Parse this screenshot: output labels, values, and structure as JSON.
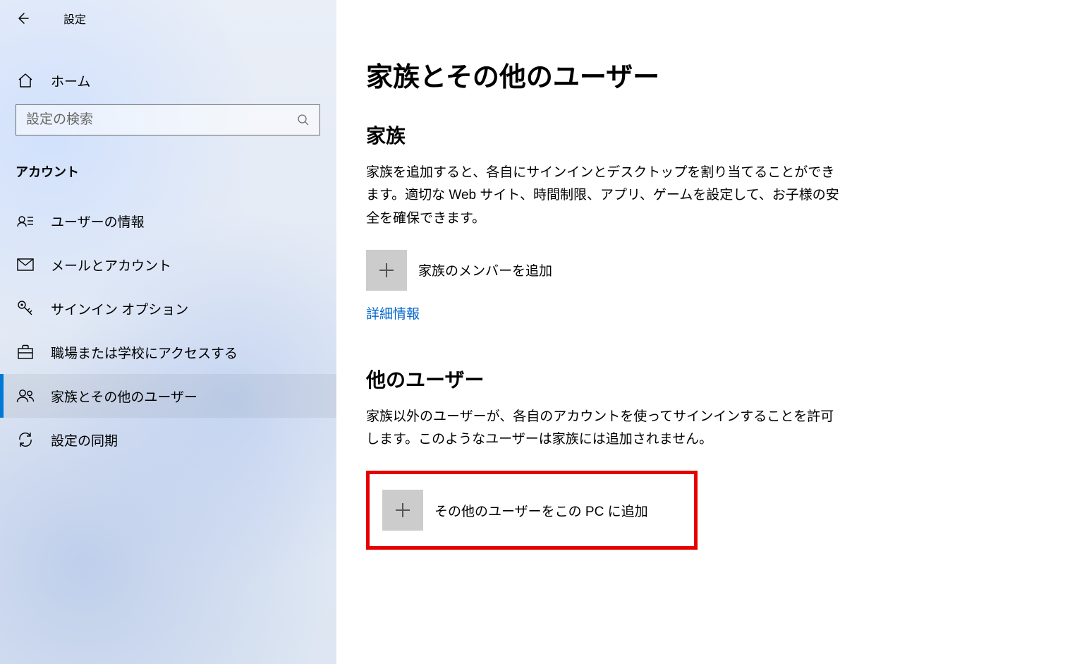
{
  "app_title": "設定",
  "sidebar": {
    "home_label": "ホーム",
    "search_placeholder": "設定の検索",
    "category_label": "アカウント",
    "items": [
      {
        "label": "ユーザーの情報",
        "icon": "user-card-icon",
        "selected": false
      },
      {
        "label": "メールとアカウント",
        "icon": "mail-icon",
        "selected": false
      },
      {
        "label": "サインイン オプション",
        "icon": "key-icon",
        "selected": false
      },
      {
        "label": "職場または学校にアクセスする",
        "icon": "briefcase-icon",
        "selected": false
      },
      {
        "label": "家族とその他のユーザー",
        "icon": "people-icon",
        "selected": true
      },
      {
        "label": "設定の同期",
        "icon": "sync-icon",
        "selected": false
      }
    ]
  },
  "main": {
    "page_title": "家族とその他のユーザー",
    "family": {
      "heading": "家族",
      "description": "家族を追加すると、各自にサインインとデスクトップを割り当てることができます。適切な Web サイト、時間制限、アプリ、ゲームを設定して、お子様の安全を確保できます。",
      "add_label": "家族のメンバーを追加",
      "detail_link": "詳細情報"
    },
    "others": {
      "heading": "他のユーザー",
      "description": "家族以外のユーザーが、各自のアカウントを使ってサインインすることを許可します。このようなユーザーは家族には追加されません。",
      "add_label": "その他のユーザーをこの PC に追加"
    }
  }
}
